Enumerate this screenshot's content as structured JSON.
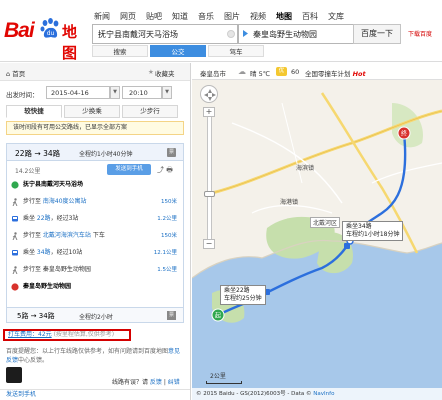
{
  "header": {
    "logo_text": "Bai",
    "logo_map": "地图",
    "nav": [
      "新闻",
      "网页",
      "贴吧",
      "知道",
      "音乐",
      "图片",
      "视频",
      "地图",
      "百科",
      "文库"
    ],
    "nav_active_index": 7,
    "search_from": "抚宁县南戴河天马浴场",
    "search_to": "秦皇岛野生动物园",
    "search_button": "百度一下",
    "download_link": "下载百度",
    "modes": [
      "搜索",
      "公交",
      "驾车"
    ],
    "mode_active_index": 1
  },
  "left": {
    "home": "首页",
    "favorites": "收藏夹",
    "datetime_label": "出发时间：",
    "date_value": "2015-04-16",
    "time_value": "20:10",
    "plan_tabs": [
      "较快捷",
      "少换乘",
      "少步行"
    ],
    "notice": "该时间段有可用公交路线，已显示全部方案",
    "route1": {
      "title": "22路 → 34路",
      "summary": "全程约1小时40分钟",
      "badge": "票",
      "distance": "14.2公里",
      "send_to_phone": "发送到手机",
      "steps": [
        {
          "icon": "start",
          "text": "抚宁县南戴河天马浴场",
          "dist": "",
          "bold": true
        },
        {
          "icon": "walk",
          "pre": "步行至 ",
          "link": "南海40度公寓站",
          "post": "",
          "dist": "150米"
        },
        {
          "icon": "bus",
          "pre": "乘坐 ",
          "link": "22路",
          "post": "，经过3站",
          "dist": "1.2公里"
        },
        {
          "icon": "walk",
          "pre": "步行至 ",
          "link": "北戴河海滨汽车站",
          "post": " 下车",
          "dist": "150米"
        },
        {
          "icon": "bus",
          "pre": "乘坐 ",
          "link": "34路",
          "post": "，经过10站",
          "dist": "12.1公里"
        },
        {
          "icon": "walk",
          "pre": "步行至 ",
          "link": "",
          "post": "秦皇岛野生动物园",
          "dist": "1.5公里"
        },
        {
          "icon": "end",
          "text": "秦皇岛野生动物园",
          "dist": "",
          "bold": true
        }
      ]
    },
    "route2": {
      "title": "5路 → 34路",
      "summary": "全程约2小时",
      "badge": "票"
    },
    "fare": {
      "value": "打车费用：42元",
      "note": "(按里程估算,仅供参考)"
    },
    "disclaimer_a": "百度提醒您：以上行车线路仅供参考，如有问题请到百度地图",
    "disclaimer_link": "意见反馈",
    "disclaimer_b": "中心反馈。",
    "feedback_pre": "线路有误？请 ",
    "feedback_links": [
      "反馈",
      "纠错"
    ],
    "copyright_link": "发送到手机"
  },
  "map": {
    "city": "秦皇岛市",
    "weather": "晴 5℃",
    "aqi_icon": "优",
    "aqi_value": "60",
    "promo": "全国零撞车计划",
    "promo_hot": "Hot",
    "labels": {
      "beidaihe": "北戴河区",
      "haibin": "海滨镇",
      "haigang": "海港镇"
    },
    "bubbles": [
      {
        "line1": "乘坐34路",
        "line2": "车程约1小时18分钟"
      },
      {
        "line1": "乘坐22路",
        "line2": "车程约25分钟"
      }
    ],
    "scale": "2公里",
    "copyright": "© 2015 Baidu - GS(2012)6003号 - Data © ",
    "copyright_link": "NavInfo"
  },
  "colors": {
    "brand_red": "#e10602",
    "link_blue": "#1a6fc4",
    "route_blue": "#2c6fdd",
    "water": "#a7c8ea",
    "green": "#c6dfac",
    "road_yellow": "#f6d870"
  }
}
